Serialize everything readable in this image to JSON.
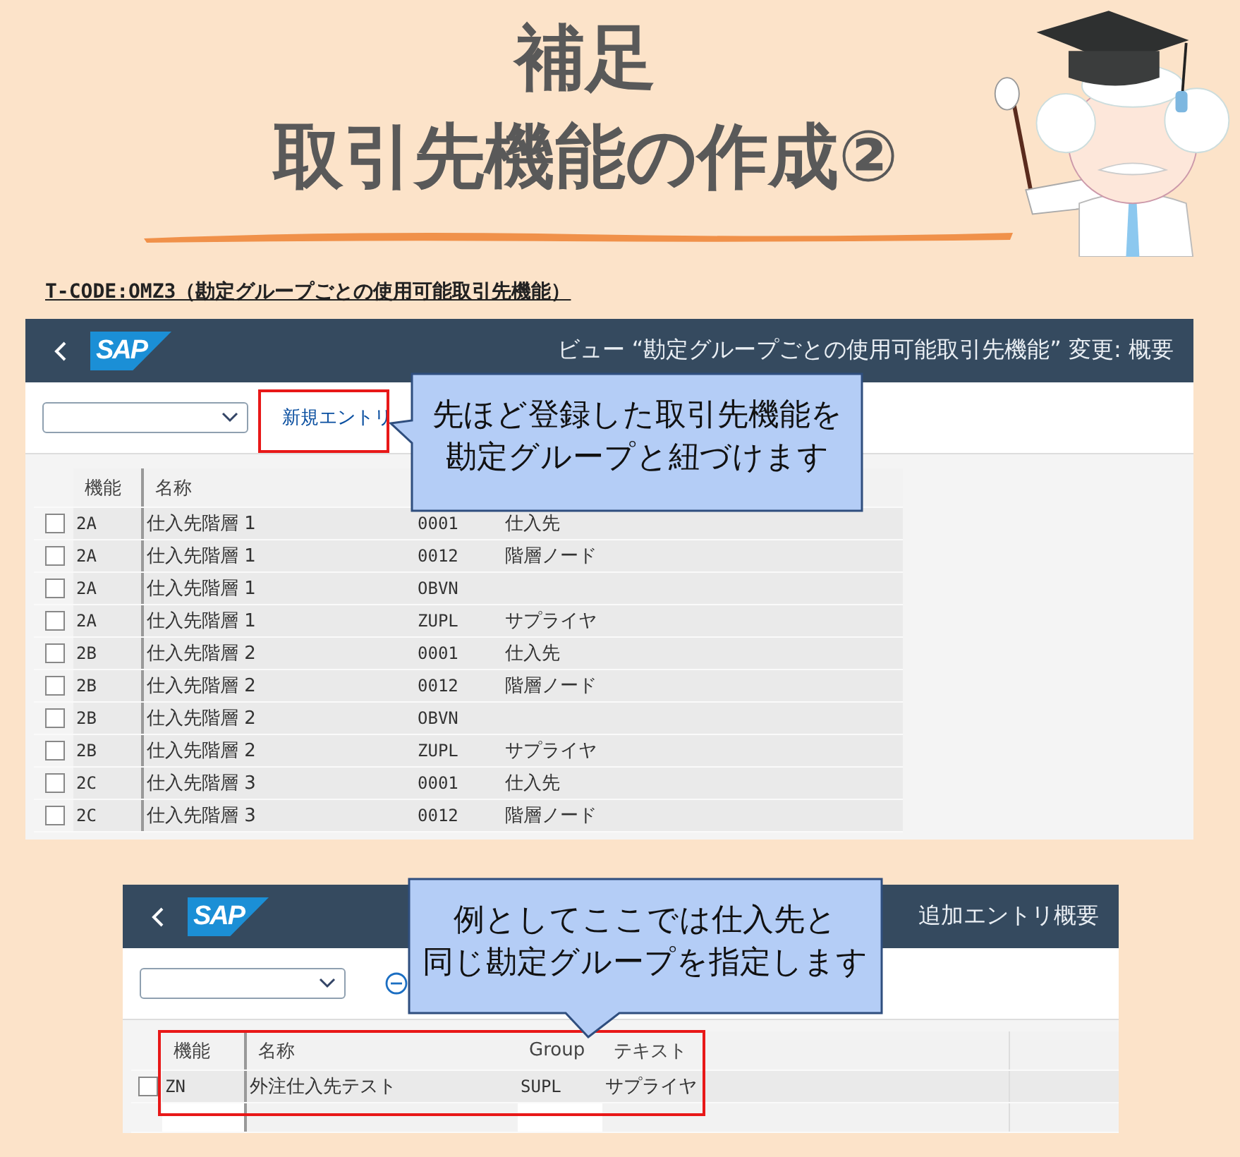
{
  "heading": {
    "lines": [
      "補足",
      "取引先機能の作成②"
    ]
  },
  "tcode_caption": "T-CODE:OMZ3（勘定グループごとの使用可能取引先機能）",
  "screen_1": {
    "logo": "SAP",
    "title": "ビュー “勘定グループごとの使用可能取引先機能” 変更: 概要",
    "new_entry_button": "新規エントリ",
    "callout": [
      "先ほど登録した取引先機能を",
      "勘定グループと紐づけます"
    ],
    "columns": [
      "機能",
      "名称"
    ],
    "rows": [
      {
        "function": "2A",
        "name": "仕入先階層 1",
        "group": "0001",
        "text": "仕入先",
        "checked": false
      },
      {
        "function": "2A",
        "name": "仕入先階層 1",
        "group": "0012",
        "text": "階層ノード",
        "checked": false
      },
      {
        "function": "2A",
        "name": "仕入先階層 1",
        "group": "OBVN",
        "checked": false
      },
      {
        "function": "2A",
        "name": "仕入先階層 1",
        "group": "ZUPL",
        "text": "サプライヤ",
        "checked": false
      },
      {
        "function": "2B",
        "name": "仕入先階層 2",
        "group": "0001",
        "text": "仕入先",
        "checked": false
      },
      {
        "function": "2B",
        "name": "仕入先階層 2",
        "group": "0012",
        "text": "階層ノード",
        "checked": false
      },
      {
        "function": "2B",
        "name": "仕入先階層 2",
        "group": "OBVN",
        "checked": false
      },
      {
        "function": "2B",
        "name": "仕入先階層 2",
        "group": "ZUPL",
        "text": "サプライヤ",
        "checked": false
      },
      {
        "function": "2C",
        "name": "仕入先階層 3",
        "group": "0001",
        "text": "仕入先",
        "checked": false
      },
      {
        "function": "2C",
        "name": "仕入先階層 3",
        "group": "0012",
        "text": "階層ノード",
        "checked": false
      }
    ]
  },
  "screen_2": {
    "logo": "SAP",
    "title": "追加エントリ概要",
    "callout": [
      "例としてここでは仕入先と",
      "同じ勘定グループを指定します"
    ],
    "columns": [
      "機能",
      "名称",
      "Group",
      "テキスト"
    ],
    "rows": [
      {
        "function": "ZN",
        "name": "外注仕入先テスト",
        "group": "SUPL",
        "text": "サプライヤ",
        "checked": false
      }
    ]
  }
}
